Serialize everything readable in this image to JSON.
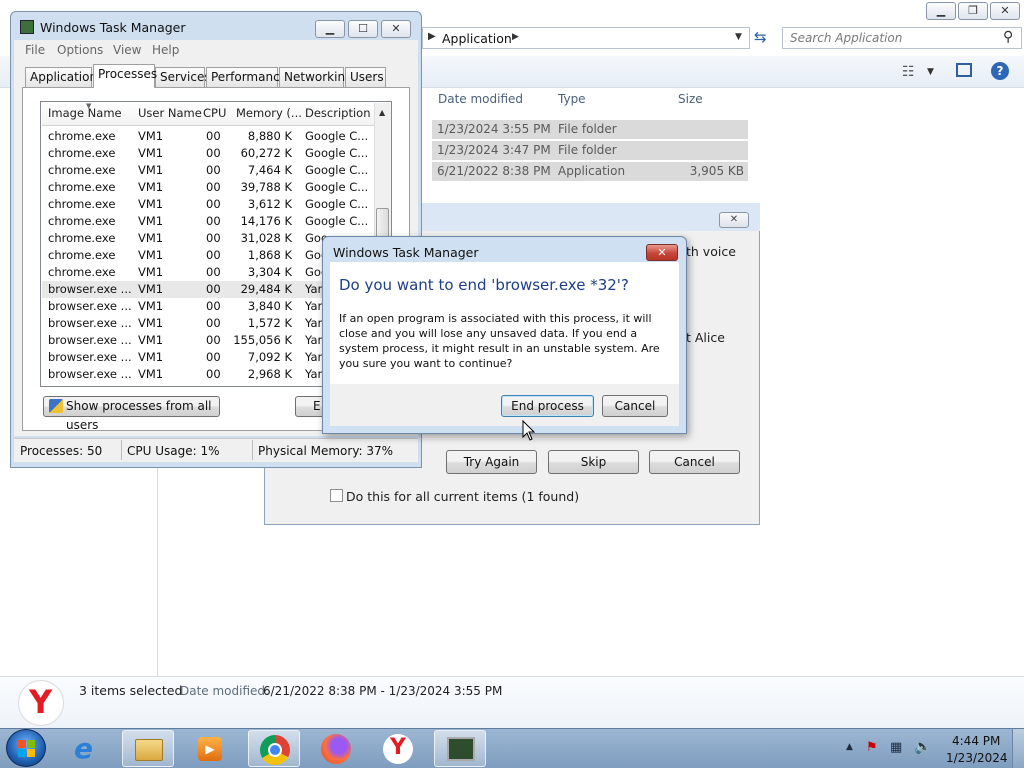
{
  "explorer": {
    "address_crumb": "Application",
    "search_placeholder": "Search Application",
    "columns": [
      "Date modified",
      "Type",
      "Size"
    ],
    "rows": [
      {
        "date": "1/23/2024 3:55 PM",
        "type": "File folder",
        "size": ""
      },
      {
        "date": "1/23/2024 3:47 PM",
        "type": "File folder",
        "size": ""
      },
      {
        "date": "6/21/2022 8:38 PM",
        "type": "Application",
        "size": "3,905 KB"
      }
    ],
    "status": {
      "selected": "3 items selected",
      "date_label": "Date modified:",
      "date_range": "6/21/2022 8:38 PM - 1/23/2024 3:55 PM"
    }
  },
  "task_manager": {
    "title": "Windows Task Manager",
    "menu": [
      "File",
      "Options",
      "View",
      "Help"
    ],
    "tabs": [
      "Applications",
      "Processes",
      "Services",
      "Performance",
      "Networking",
      "Users"
    ],
    "selected_tab": "Processes",
    "columns": [
      "Image Name",
      "User Name",
      "CPU",
      "Memory (...",
      "Description"
    ],
    "processes": [
      {
        "name": "chrome.exe",
        "user": "VM1",
        "cpu": "00",
        "mem": "8,880 K",
        "desc": "Google C..."
      },
      {
        "name": "chrome.exe",
        "user": "VM1",
        "cpu": "00",
        "mem": "60,272 K",
        "desc": "Google C..."
      },
      {
        "name": "chrome.exe",
        "user": "VM1",
        "cpu": "00",
        "mem": "7,464 K",
        "desc": "Google C..."
      },
      {
        "name": "chrome.exe",
        "user": "VM1",
        "cpu": "00",
        "mem": "39,788 K",
        "desc": "Google C..."
      },
      {
        "name": "chrome.exe",
        "user": "VM1",
        "cpu": "00",
        "mem": "3,612 K",
        "desc": "Google C..."
      },
      {
        "name": "chrome.exe",
        "user": "VM1",
        "cpu": "00",
        "mem": "14,176 K",
        "desc": "Google C..."
      },
      {
        "name": "chrome.exe",
        "user": "VM1",
        "cpu": "00",
        "mem": "31,028 K",
        "desc": "Goo"
      },
      {
        "name": "chrome.exe",
        "user": "VM1",
        "cpu": "00",
        "mem": "1,868 K",
        "desc": "Goo"
      },
      {
        "name": "chrome.exe",
        "user": "VM1",
        "cpu": "00",
        "mem": "3,304 K",
        "desc": "Goo"
      },
      {
        "name": "browser.exe ...",
        "user": "VM1",
        "cpu": "00",
        "mem": "29,484 K",
        "desc": "Yan"
      },
      {
        "name": "browser.exe ...",
        "user": "VM1",
        "cpu": "00",
        "mem": "3,840 K",
        "desc": "Yan"
      },
      {
        "name": "browser.exe ...",
        "user": "VM1",
        "cpu": "00",
        "mem": "1,572 K",
        "desc": "Yan"
      },
      {
        "name": "browser.exe ...",
        "user": "VM1",
        "cpu": "00",
        "mem": "155,056 K",
        "desc": "Yan"
      },
      {
        "name": "browser.exe ...",
        "user": "VM1",
        "cpu": "00",
        "mem": "7,092 K",
        "desc": "Yan"
      },
      {
        "name": "browser.exe ...",
        "user": "VM1",
        "cpu": "00",
        "mem": "2,968 K",
        "desc": "Yan"
      }
    ],
    "selected_row": 9,
    "show_all_label": "Show processes from all users",
    "end_label_partial": "E",
    "status": {
      "processes": "Processes: 50",
      "cpu": "CPU Usage: 1%",
      "memory": "Physical Memory: 37%"
    }
  },
  "file_dialog": {
    "partial_text_1": "th voice",
    "partial_text_2": "t Alice",
    "try_again_label": "Try Again",
    "skip_label": "Skip",
    "cancel_label": "Cancel",
    "checkbox_label": "Do this for all current items (1 found)"
  },
  "confirm_dialog": {
    "title": "Windows Task Manager",
    "heading": "Do you want to end 'browser.exe *32'?",
    "body": "If an open program is associated with this process, it will close and you will lose any unsaved data. If you end a system process, it might result in an unstable system. Are you sure you want to continue?",
    "end_label": "End process",
    "cancel_label": "Cancel"
  },
  "taskbar": {
    "time": "4:44 PM",
    "date": "1/23/2024"
  },
  "colors": {
    "heading_blue": "#1e3e8a",
    "taskbar": "#8facce",
    "close_red": "#c7473a"
  }
}
